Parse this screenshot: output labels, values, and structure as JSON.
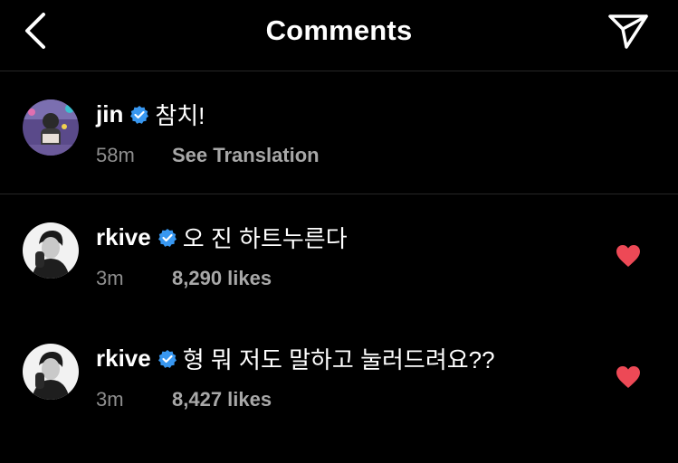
{
  "header": {
    "title": "Comments",
    "back_icon": "chevron-left-icon",
    "send_icon": "paper-plane-icon"
  },
  "colors": {
    "background": "#000000",
    "verified": "#3897f0",
    "heart": "#ed4956",
    "meta": "#8e8e8e"
  },
  "comments": [
    {
      "username": "jin",
      "verified": true,
      "text": "참치!",
      "time": "58m",
      "action": "See Translation",
      "liked": false
    },
    {
      "username": "rkive",
      "verified": true,
      "text": "오 진 하트누른다",
      "time": "3m",
      "action": "8,290 likes",
      "liked": true
    },
    {
      "username": "rkive",
      "verified": true,
      "text": "형 뭐 저도 말하고 눌러드려요??",
      "time": "3m",
      "action": "8,427 likes",
      "liked": true
    }
  ]
}
